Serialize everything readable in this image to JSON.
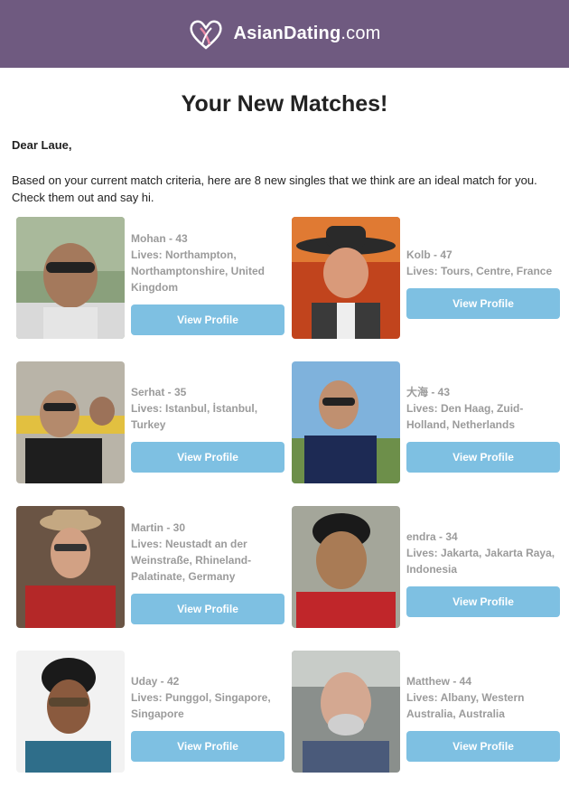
{
  "header": {
    "brand_main": "AsianDating",
    "brand_tld": ".com",
    "logo_icon": "heart-logo-icon",
    "background": "#6f5a80"
  },
  "title": "Your New Matches!",
  "greeting": "Dear Laue,",
  "intro": "Based on your current match criteria, here are 8 new singles that we think are an ideal match for you. Check them out and say hi.",
  "button_color": "#7ec0e2",
  "matches": [
    {
      "name": "Mohan - 43",
      "lives": "Lives: Northampton, Northamptonshire, United Kingdom",
      "button": "View Profile"
    },
    {
      "name": "Kolb - 47",
      "lives": "Lives: Tours, Centre, France",
      "button": "View Profile"
    },
    {
      "name": "Serhat - 35",
      "lives": "Lives: Istanbul, İstanbul, Turkey",
      "button": "View Profile"
    },
    {
      "name": "大海 - 43",
      "lives": "Lives: Den Haag, Zuid-Holland, Netherlands",
      "button": "View Profile"
    },
    {
      "name": "Martin - 30",
      "lives": "Lives: Neustadt an der Weinstraße, Rhineland-Palatinate, Germany",
      "button": "View Profile"
    },
    {
      "name": "endra - 34",
      "lives": "Lives: Jakarta, Jakarta Raya, Indonesia",
      "button": "View Profile"
    },
    {
      "name": "Uday - 42",
      "lives": "Lives: Punggol, Singapore, Singapore",
      "button": "View Profile"
    },
    {
      "name": "Matthew - 44",
      "lives": "Lives: Albany, Western Australia, Australia",
      "button": "View Profile"
    }
  ]
}
